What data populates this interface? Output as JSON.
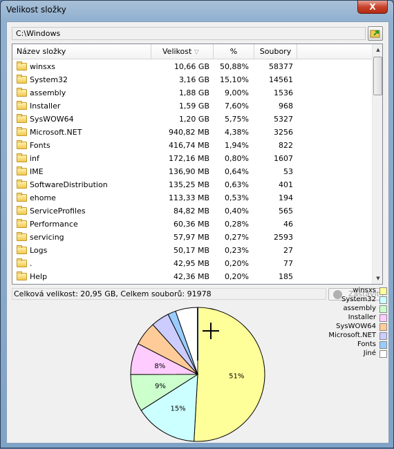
{
  "window": {
    "title": "Velikost složky",
    "close_label": "X"
  },
  "path": "C:\\Windows",
  "columns": [
    "Název složky",
    "Velikost",
    "%",
    "Soubory"
  ],
  "sort_indicator": "▽",
  "rows": [
    {
      "name": "winsxs",
      "size": "10,66 GB",
      "pct": "50,88%",
      "files": "58377"
    },
    {
      "name": "System32",
      "size": "3,16 GB",
      "pct": "15,10%",
      "files": "14561"
    },
    {
      "name": "assembly",
      "size": "1,88 GB",
      "pct": "9,00%",
      "files": "1536"
    },
    {
      "name": "Installer",
      "size": "1,59 GB",
      "pct": "7,60%",
      "files": "968"
    },
    {
      "name": "SysWOW64",
      "size": "1,20 GB",
      "pct": "5,75%",
      "files": "5327"
    },
    {
      "name": "Microsoft.NET",
      "size": "940,82 MB",
      "pct": "4,38%",
      "files": "3256"
    },
    {
      "name": "Fonts",
      "size": "416,74 MB",
      "pct": "1,94%",
      "files": "822"
    },
    {
      "name": "inf",
      "size": "172,16 MB",
      "pct": "0,80%",
      "files": "1607"
    },
    {
      "name": "IME",
      "size": "136,90 MB",
      "pct": "0,64%",
      "files": "53"
    },
    {
      "name": "SoftwareDistribution",
      "size": "135,25 MB",
      "pct": "0,63%",
      "files": "401"
    },
    {
      "name": "ehome",
      "size": "113,33 MB",
      "pct": "0,53%",
      "files": "194"
    },
    {
      "name": "ServiceProfiles",
      "size": "84,82 MB",
      "pct": "0,40%",
      "files": "565"
    },
    {
      "name": "Performance",
      "size": "60,36 MB",
      "pct": "0,28%",
      "files": "46"
    },
    {
      "name": "servicing",
      "size": "57,97 MB",
      "pct": "0,27%",
      "files": "2593"
    },
    {
      "name": "Logs",
      "size": "50,17 MB",
      "pct": "0,23%",
      "files": "27"
    },
    {
      "name": ".",
      "size": "42,95 MB",
      "pct": "0,20%",
      "files": "77"
    },
    {
      "name": "Help",
      "size": "42,36 MB",
      "pct": "0,20%",
      "files": "185"
    }
  ],
  "status": "Celková velikost: 20,95 GB, Celkem souborů: 91978",
  "stop_label": "Zastavit",
  "chart_data": {
    "type": "pie",
    "start": "top",
    "direction": "clockwise",
    "slices": [
      {
        "name": "winsxs",
        "value": 50.88,
        "label": "51%",
        "color": "#ffff99"
      },
      {
        "name": "System32",
        "value": 15.1,
        "label": "15%",
        "color": "#ccffff"
      },
      {
        "name": "assembly",
        "value": 9.0,
        "label": "9%",
        "color": "#ccffcc"
      },
      {
        "name": "Installer",
        "value": 7.6,
        "label": "8%",
        "color": "#ffccff"
      },
      {
        "name": "SysWOW64",
        "value": 5.75,
        "label": "",
        "color": "#ffcc99"
      },
      {
        "name": "Microsoft.NET",
        "value": 4.38,
        "label": "",
        "color": "#ccccff"
      },
      {
        "name": "Fonts",
        "value": 1.94,
        "label": "",
        "color": "#99ccff"
      },
      {
        "name": "Jiné",
        "value": 5.35,
        "label": "",
        "color": "#ffffff"
      }
    ],
    "legend": "right"
  }
}
